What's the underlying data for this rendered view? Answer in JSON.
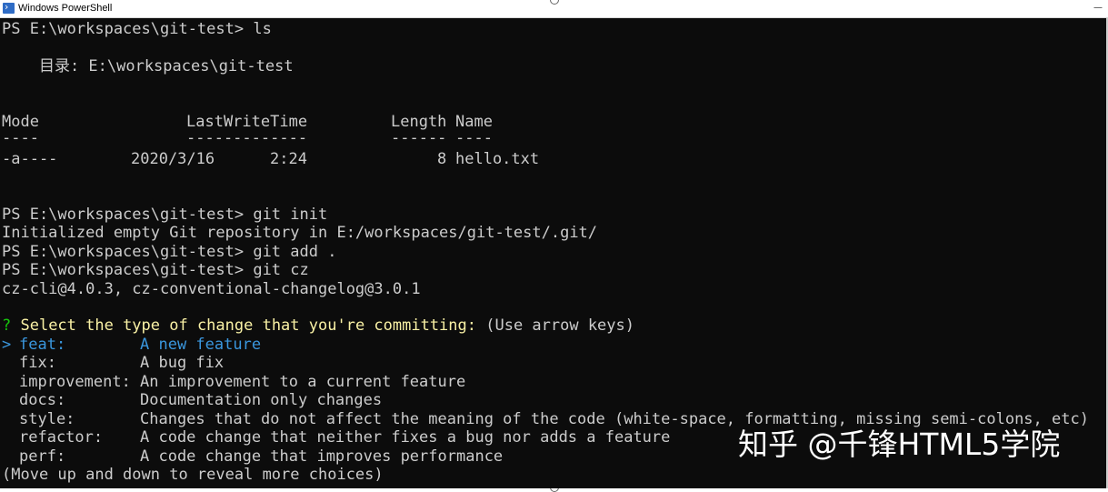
{
  "window": {
    "title": "Windows PowerShell",
    "icon": "powershell-icon"
  },
  "console": {
    "lines": {
      "l1": "PS E:\\workspaces\\git-test> ls",
      "l2": "    目录: E:\\workspaces\\git-test",
      "l3_mode": "Mode",
      "l3_lwt": "LastWriteTime",
      "l3_len": "Length",
      "l3_name": "Name",
      "l4_mode": "----",
      "l4_lwt": "-------------",
      "l4_len": "------",
      "l4_name": "----",
      "l5_mode": "-a----",
      "l5_date": "2020/3/16",
      "l5_time": "2:24",
      "l5_len": "8",
      "l5_name": "hello.txt",
      "l6": "PS E:\\workspaces\\git-test> git init",
      "l7": "Initialized empty Git repository in E:/workspaces/git-test/.git/",
      "l8": "PS E:\\workspaces\\git-test> git add .",
      "l9": "PS E:\\workspaces\\git-test> git cz",
      "l10": "cz-cli@4.0.3, cz-conventional-changelog@3.0.1"
    },
    "prompt": {
      "marker": "?",
      "question": " Select the type of change that you're committing:",
      "hint": " (Use arrow keys)"
    },
    "choices": [
      {
        "cursor": ">",
        "key": "feat:       ",
        "desc": "A new feature"
      },
      {
        "cursor": " ",
        "key": "fix:        ",
        "desc": "A bug fix"
      },
      {
        "cursor": " ",
        "key": "improvement:",
        "desc": "An improvement to a current feature"
      },
      {
        "cursor": " ",
        "key": "docs:       ",
        "desc": "Documentation only changes"
      },
      {
        "cursor": " ",
        "key": "style:      ",
        "desc": "Changes that do not affect the meaning of the code (white-space, formatting, missing semi-colons, etc)"
      },
      {
        "cursor": " ",
        "key": "refactor:   ",
        "desc": "A code change that neither fixes a bug nor adds a feature"
      },
      {
        "cursor": " ",
        "key": "perf:       ",
        "desc": "A code change that improves performance"
      }
    ],
    "footer": "(Move up and down to reveal more choices)"
  },
  "watermark": "知乎 @千锋HTML5学院"
}
